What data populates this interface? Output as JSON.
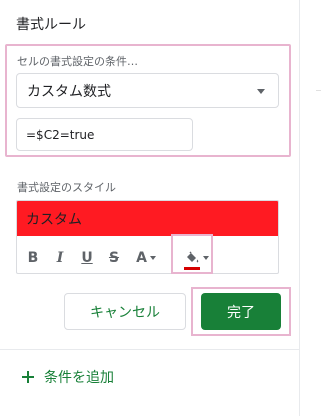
{
  "panel": {
    "title": "書式ルール"
  },
  "condition": {
    "label": "セルの書式設定の条件…",
    "selected": "カスタム数式",
    "formula": "=$C2=true"
  },
  "style": {
    "label": "書式設定のスタイル",
    "preview_text": "カスタム",
    "preview_color": "#ff1a22",
    "toolbar": {
      "bold": "B",
      "italic": "I",
      "underline": "U",
      "strike": "S",
      "text_color": "A",
      "fill_icon": "paint-bucket-icon",
      "fill_color": "#d50000"
    }
  },
  "actions": {
    "cancel": "キャンセル",
    "done": "完了"
  },
  "add_condition": "条件を追加",
  "colors": {
    "accent": "#188038",
    "highlight": "#e8b4cf"
  }
}
